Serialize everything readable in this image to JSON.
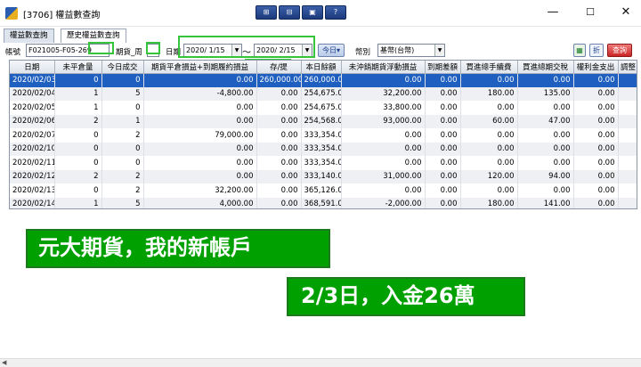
{
  "window": {
    "title": "[3706] 權益數查詢",
    "tools": [
      "⊞",
      "⊟",
      "▣",
      "?"
    ],
    "minimize": "—",
    "maximize": "☐",
    "close": "✕"
  },
  "tabs": [
    {
      "label": "權益數查詢",
      "active": false
    },
    {
      "label": "歷史權益數查詢",
      "active": true
    }
  ],
  "toolbar": {
    "account_label": "帳號",
    "account_value": "F021005-F05-269",
    "period_label": "期貨_周",
    "date_label": "日期",
    "date_from": "2020/ 1/15",
    "date_sep": "～",
    "date_to": "2020/ 2/15",
    "today_button": "今日▾",
    "currency_label": "幣別",
    "currency_value": "基幣(台幣)",
    "fold_button": "折",
    "query_button": "查詢"
  },
  "table": {
    "columns": [
      "日期",
      "未平倉量",
      "今日成交",
      "期貨平倉損益+到期履約損益",
      "存/提",
      "本日餘額",
      "未沖銷期貨浮動損益",
      "到期差額",
      "買進總手續費",
      "買進總期交稅",
      "權利金支出",
      "調整"
    ],
    "rows": [
      [
        "2020/02/03",
        "0",
        "0",
        "0.00",
        "260,000.00",
        "260,000.00",
        "0.00",
        "0.00",
        "0.00",
        "0.00",
        "0.00",
        ""
      ],
      [
        "2020/02/04",
        "1",
        "5",
        "-4,800.00",
        "0.00",
        "254,675.00",
        "32,200.00",
        "0.00",
        "180.00",
        "135.00",
        "0.00",
        ""
      ],
      [
        "2020/02/05",
        "1",
        "0",
        "0.00",
        "0.00",
        "254,675.00",
        "33,800.00",
        "0.00",
        "0.00",
        "0.00",
        "0.00",
        ""
      ],
      [
        "2020/02/06",
        "2",
        "1",
        "0.00",
        "0.00",
        "254,568.00",
        "93,000.00",
        "0.00",
        "60.00",
        "47.00",
        "0.00",
        ""
      ],
      [
        "2020/02/07",
        "0",
        "2",
        "79,000.00",
        "0.00",
        "333,354.00",
        "0.00",
        "0.00",
        "0.00",
        "0.00",
        "0.00",
        ""
      ],
      [
        "2020/02/10",
        "0",
        "0",
        "0.00",
        "0.00",
        "333,354.00",
        "0.00",
        "0.00",
        "0.00",
        "0.00",
        "0.00",
        ""
      ],
      [
        "2020/02/11",
        "0",
        "0",
        "0.00",
        "0.00",
        "333,354.00",
        "0.00",
        "0.00",
        "0.00",
        "0.00",
        "0.00",
        ""
      ],
      [
        "2020/02/12",
        "2",
        "2",
        "0.00",
        "0.00",
        "333,140.00",
        "31,000.00",
        "0.00",
        "120.00",
        "94.00",
        "0.00",
        ""
      ],
      [
        "2020/02/13",
        "0",
        "2",
        "32,200.00",
        "0.00",
        "365,126.00",
        "0.00",
        "0.00",
        "0.00",
        "0.00",
        "0.00",
        ""
      ],
      [
        "2020/02/14",
        "1",
        "5",
        "4,000.00",
        "0.00",
        "368,591.00",
        "-2,000.00",
        "0.00",
        "180.00",
        "141.00",
        "0.00",
        ""
      ]
    ]
  },
  "overlay": {
    "caption1": "元大期貨，我的新帳戶",
    "caption2": "2/3日，入金26萬"
  },
  "colors": {
    "selected_row": "#1f5fbf",
    "highlight": "#35c43b",
    "banner": "#00a000"
  }
}
